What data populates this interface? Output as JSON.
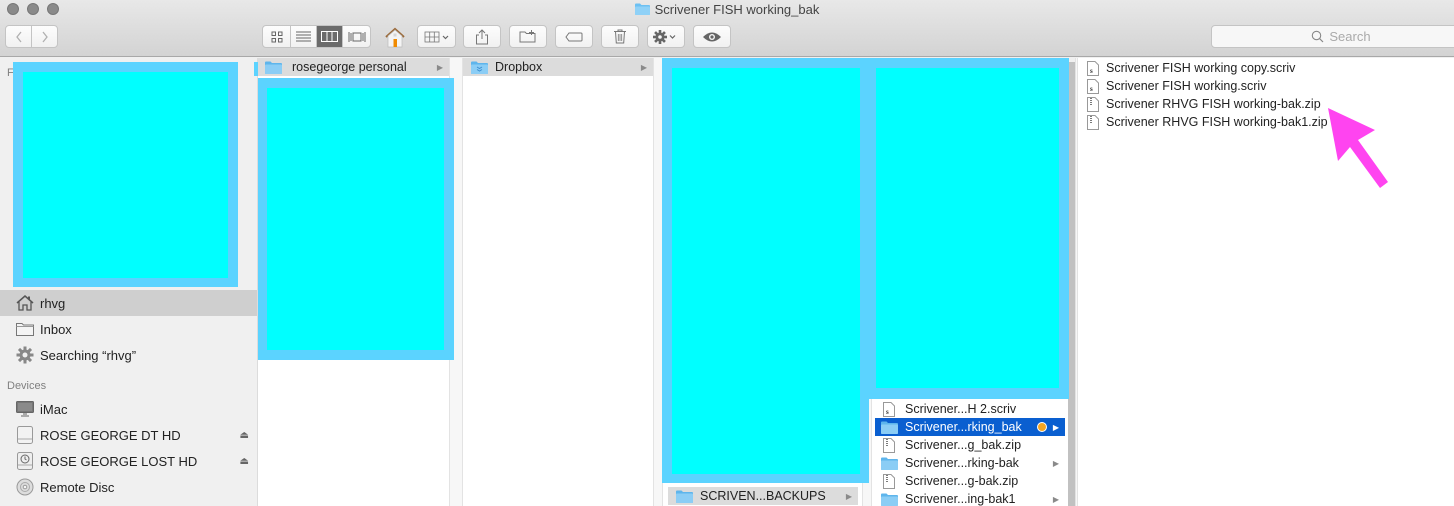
{
  "window": {
    "title": "Scrivener FISH working_bak",
    "traffic_lights": [
      "close",
      "minimize",
      "zoom"
    ]
  },
  "toolbar": {
    "back_icon": "chevron-left-icon",
    "forward_icon": "chevron-right-icon",
    "view_modes": [
      {
        "name": "icon-view",
        "active": false
      },
      {
        "name": "list-view",
        "active": false
      },
      {
        "name": "column-view",
        "active": true
      },
      {
        "name": "cover-flow-view",
        "active": false
      }
    ],
    "buttons": [
      "home",
      "arrange",
      "share",
      "new-folder",
      "tags",
      "delete",
      "action",
      "quick-look"
    ],
    "search_placeholder": "Search"
  },
  "sidebar": {
    "favorites_heading": "F",
    "items": [
      {
        "label": "rhvg",
        "icon": "home-icon",
        "selected": true
      },
      {
        "label": "Inbox",
        "icon": "folder-icon",
        "selected": false
      },
      {
        "label": "Searching “rhvg”",
        "icon": "gear-icon",
        "selected": false
      }
    ],
    "devices_heading": "Devices",
    "devices": [
      {
        "label": "iMac",
        "icon": "imac-icon",
        "eject": false
      },
      {
        "label": "ROSE GEORGE DT HD",
        "icon": "drive-icon",
        "eject": true
      },
      {
        "label": "ROSE GEORGE LOST HD",
        "icon": "time-machine-drive-icon",
        "eject": true
      },
      {
        "label": "Remote Disc",
        "icon": "disc-icon",
        "eject": false
      }
    ]
  },
  "columns": [
    {
      "items": [
        {
          "label": "rosegeorge personal",
          "icon": "folder-icon",
          "has_children": true,
          "state": "parent-selected"
        }
      ]
    },
    {
      "items": [
        {
          "label": "Dropbox",
          "icon": "dropbox-folder-icon",
          "has_children": true,
          "state": "parent-selected"
        }
      ]
    },
    {
      "items": [
        {
          "label": "SCRIVEN...BACKUPS",
          "icon": "folder-icon",
          "has_children": true,
          "state": "parent-selected"
        }
      ]
    },
    {
      "items": [
        {
          "label": "Scrivener...H 2.scriv",
          "icon": "scrivener-file-icon",
          "has_children": false,
          "state": "none"
        },
        {
          "label": "Scrivener...rking_bak",
          "icon": "folder-icon",
          "has_children": true,
          "state": "selected",
          "tag_color": "#f5a623"
        },
        {
          "label": "Scrivener...g_bak.zip",
          "icon": "zip-file-icon",
          "has_children": false,
          "state": "none"
        },
        {
          "label": "Scrivener...rking-bak",
          "icon": "folder-icon",
          "has_children": true,
          "state": "none"
        },
        {
          "label": "Scrivener...g-bak.zip",
          "icon": "zip-file-icon",
          "has_children": false,
          "state": "none"
        },
        {
          "label": "Scrivener...ing-bak1",
          "icon": "folder-icon",
          "has_children": true,
          "state": "none"
        }
      ]
    },
    {
      "items": [
        {
          "label": "Scrivener FISH working copy.scriv",
          "icon": "scrivener-file-icon"
        },
        {
          "label": "Scrivener FISH working.scriv",
          "icon": "scrivener-file-icon"
        },
        {
          "label": "Scrivener RHVG FISH working-bak.zip",
          "icon": "zip-file-icon"
        },
        {
          "label": "Scrivener RHVG FISH working-bak1.zip",
          "icon": "zip-file-icon"
        }
      ]
    }
  ],
  "annotation": {
    "type": "arrow",
    "color": "#ff44f0",
    "points_to": "Scrivener RHVG FISH working-bak.zip"
  },
  "colors": {
    "selection": "#0a5fd0",
    "redaction_outer": "#5bd3ff",
    "redaction_inner": "#00ffff"
  }
}
